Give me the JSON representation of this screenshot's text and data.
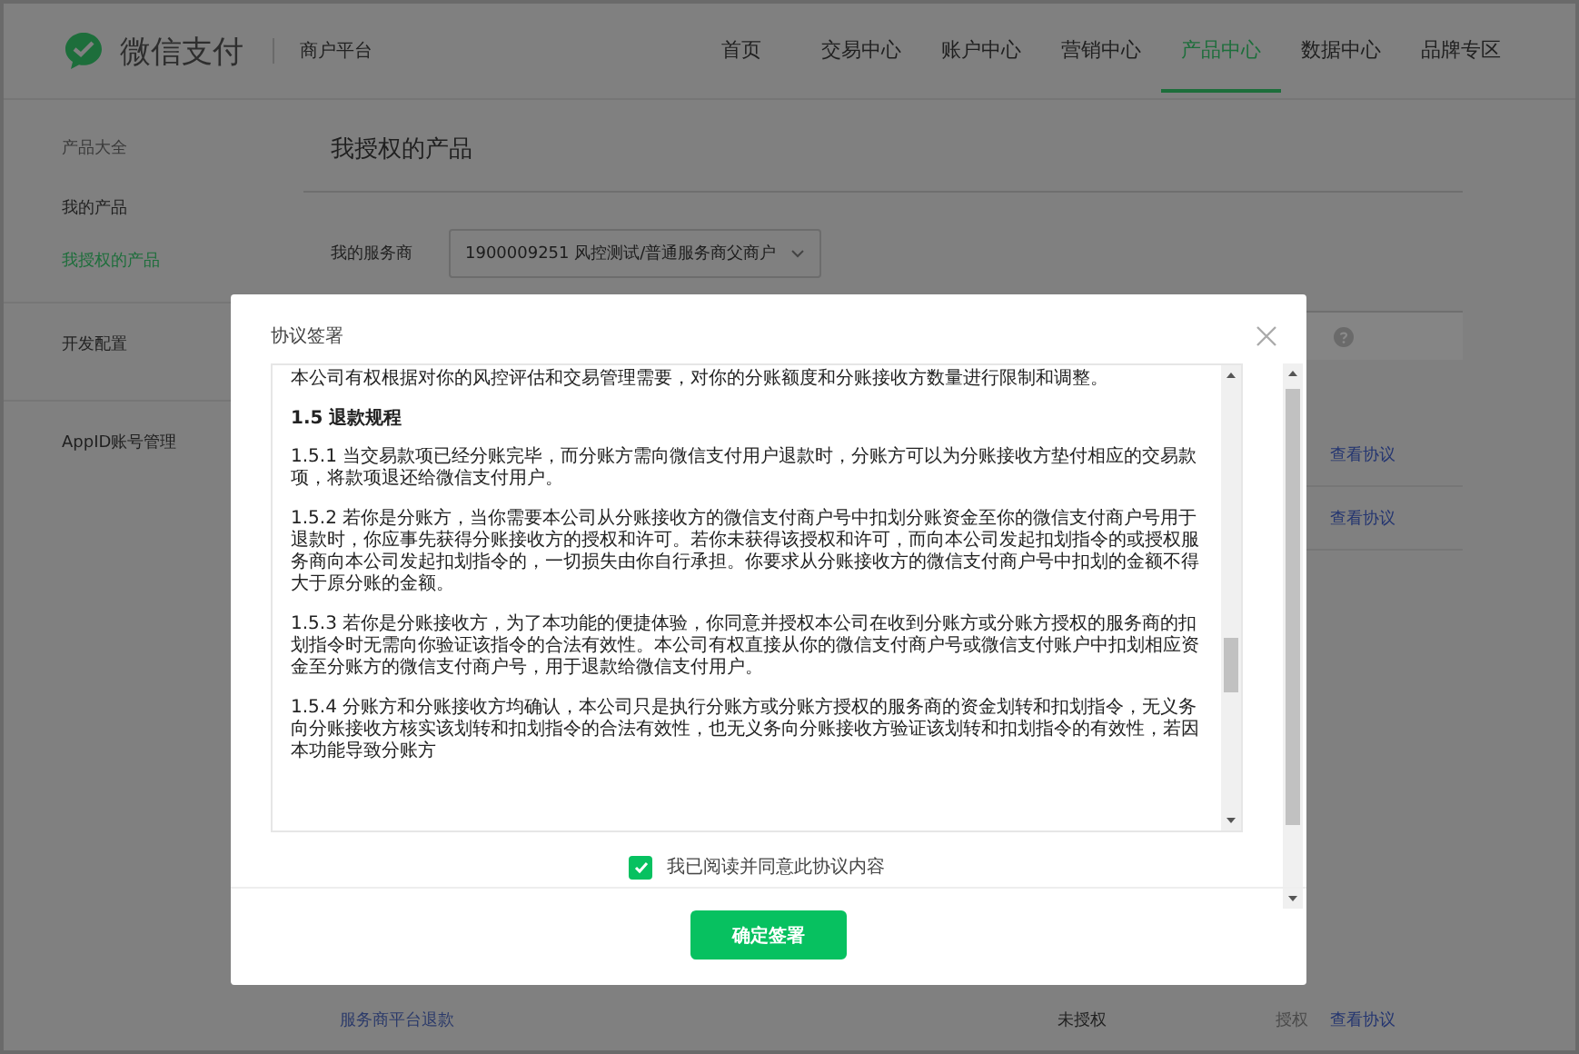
{
  "header": {
    "logo_text": "微信支付",
    "subtitle": "商户平台",
    "nav": [
      {
        "label": "首页",
        "selected": false
      },
      {
        "label": "交易中心",
        "selected": false
      },
      {
        "label": "账户中心",
        "selected": false
      },
      {
        "label": "营销中心",
        "selected": false
      },
      {
        "label": "产品中心",
        "selected": true
      },
      {
        "label": "数据中心",
        "selected": false
      },
      {
        "label": "品牌专区",
        "selected": false
      }
    ]
  },
  "sidebar": {
    "items": [
      {
        "kind": "heading",
        "label": "产品大全"
      },
      {
        "kind": "link",
        "label": "我的产品",
        "selected": false
      },
      {
        "kind": "link",
        "label": "我授权的产品",
        "selected": true
      },
      {
        "kind": "section",
        "label": "开发配置",
        "selected": false
      },
      {
        "kind": "section",
        "label": "AppID账号管理",
        "selected": false
      }
    ]
  },
  "page": {
    "title": "我授权的产品",
    "provider_label": "我的服务商",
    "provider_value": "1900009251 风控测试/普通服务商父商户"
  },
  "table": {
    "rows": [
      {
        "action": "查看协议"
      },
      {
        "action": "查看协议"
      },
      {
        "name": "服务商平台退款",
        "status": "未授权",
        "authorize": "授权",
        "action": "查看协议"
      }
    ]
  },
  "dialog": {
    "title": "协议签署",
    "paragraphs": [
      {
        "kind": "text",
        "text": "本公司有权根据对你的风控评估和交易管理需要，对你的分账额度和分账接收方数量进行限制和调整。"
      },
      {
        "kind": "heading",
        "text": "1.5 退款规程"
      },
      {
        "kind": "text",
        "text": "1.5.1 当交易款项已经分账完毕，而分账方需向微信支付用户退款时，分账方可以为分账接收方垫付相应的交易款项，将款项退还给微信支付用户。"
      },
      {
        "kind": "text",
        "text": "1.5.2 若你是分账方，当你需要本公司从分账接收方的微信支付商户号中扣划分账资金至你的微信支付商户号用于退款时，你应事先获得分账接收方的授权和许可。若你未获得该授权和许可，而向本公司发起扣划指令的或授权服务商向本公司发起扣划指令的，一切损失由你自行承担。你要求从分账接收方的微信支付商户号中扣划的金额不得大于原分账的金额。"
      },
      {
        "kind": "text",
        "text": "1.5.3 若你是分账接收方，为了本功能的便捷体验，你同意并授权本公司在收到分账方或分账方授权的服务商的扣划指令时无需向你验证该指令的合法有效性。本公司有权直接从你的微信支付商户号或微信支付账户中扣划相应资金至分账方的微信支付商户号，用于退款给微信支付用户。"
      },
      {
        "kind": "text",
        "text": "1.5.4 分账方和分账接收方均确认，本公司只是执行分账方或分账方授权的服务商的资金划转和扣划指令，无义务向分账接收方核实该划转和扣划指令的合法有效性，也无义务向分账接收方验证该划转和扣划指令的有效性，若因本功能导致分账方"
      }
    ],
    "agreement": {
      "label": "我已阅读并同意此协议内容",
      "checked": true
    },
    "confirm_button": "确定签署"
  }
}
